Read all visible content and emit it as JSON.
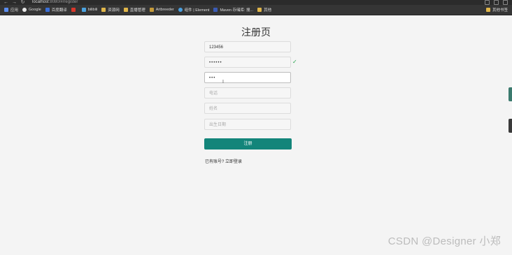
{
  "browser": {
    "url_host": "localhost",
    "url_path": ":8080/#/register",
    "bookmarks": [
      {
        "label": "应用",
        "color": "#5b8def"
      },
      {
        "label": "Google",
        "color": "#e8e8e8"
      },
      {
        "label": "百度翻译",
        "color": "#3a6fd8"
      },
      {
        "label": "",
        "color": "#d9372b"
      },
      {
        "label": "bilibili",
        "color": "#4ba3e0"
      },
      {
        "label": "资源网",
        "color": "#e0b64a"
      },
      {
        "label": "直播管理",
        "color": "#e0b64a"
      },
      {
        "label": "Artbreeder",
        "color": "#c49a3a"
      },
      {
        "label": "组件 | Element",
        "color": "#4aa0e0"
      },
      {
        "label": "Maven 存储库: 搜...",
        "color": "#3b5bb5"
      },
      {
        "label": "其他",
        "color": "#e0b64a"
      }
    ],
    "bookmark_right": {
      "label": "其他书签",
      "color": "#e0b64a"
    }
  },
  "form": {
    "title": "注册页",
    "username_value": "123456",
    "password_value": "••••••",
    "confirm_value": "•••",
    "phone_placeholder": "电话",
    "name_placeholder": "姓名",
    "birthday_placeholder": "出生日期",
    "submit_label": "注册",
    "has_account_text": "已有账号?",
    "login_link": "立即登录",
    "check_mark": "✓",
    "cursor_glyph": "I"
  },
  "watermark": "CSDN @Designer 小郑",
  "colors": {
    "primary": "#13857a",
    "valid": "#22a34a"
  }
}
